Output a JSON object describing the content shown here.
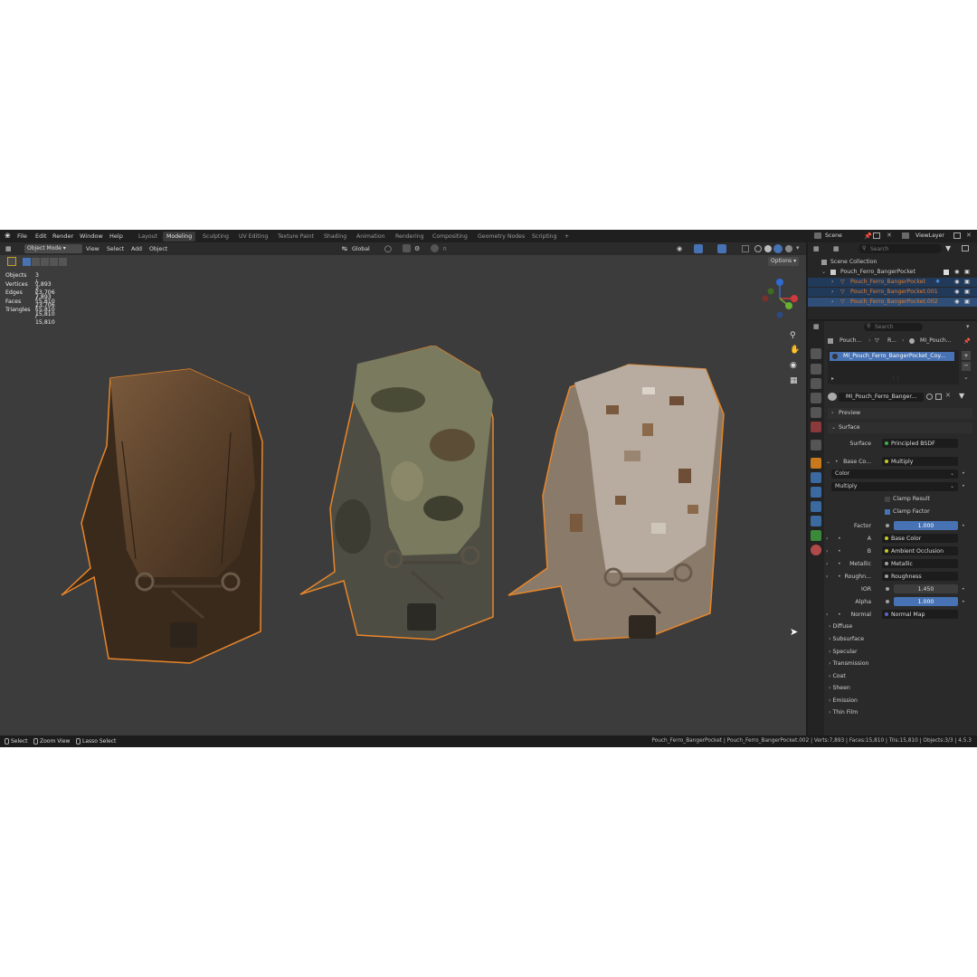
{
  "menubar": {
    "menus": [
      "File",
      "Edit",
      "Render",
      "Window",
      "Help"
    ],
    "workspaces": [
      "Layout",
      "Modeling",
      "Sculpting",
      "UV Editing",
      "Texture Paint",
      "Shading",
      "Animation",
      "Rendering",
      "Compositing",
      "Geometry Nodes",
      "Scripting"
    ],
    "active_workspace": "Modeling",
    "add_tab": "+",
    "scene": "Scene",
    "view_layer": "ViewLayer"
  },
  "viewport": {
    "mode": "Object Mode",
    "menus": [
      "View",
      "Select",
      "Add",
      "Object"
    ],
    "transform_orientation": "Global",
    "options_label": "Options",
    "stats": [
      {
        "label": "Objects",
        "value": "3 / 3"
      },
      {
        "label": "Vertices",
        "value": "7,893 / 7,893"
      },
      {
        "label": "Edges",
        "value": "23,706 / 23,706"
      },
      {
        "label": "Faces",
        "value": "15,810 / 15,810"
      },
      {
        "label": "Triangles",
        "value": "15,810 / 15,810"
      }
    ],
    "colors": {
      "background": "#3c3c3c",
      "selection_outline": "#e8862a"
    }
  },
  "outliner": {
    "search_placeholder": "Search",
    "scene_collection": "Scene Collection",
    "collection": "Pouch_Ferro_BangerPocket",
    "objects": [
      "Pouch_Ferro_BangerPocket",
      "Pouch_Ferro_BangerPocket.001",
      "Pouch_Ferro_BangerPocket.002"
    ]
  },
  "properties": {
    "search_placeholder": "Search",
    "breadcrumb": [
      "Pouch...",
      "R...",
      "MI_Pouch..."
    ],
    "material_slot": "MI_Pouch_Ferro_BangerPocket_Coy...",
    "material_name": "MI_Pouch_Ferro_Banger...",
    "panels": {
      "preview": "Preview",
      "surface": "Surface"
    },
    "surface_label": "Surface",
    "surface_value": "Principled BSDF",
    "base_color_label": "Base Co...",
    "base_color_value": "Multiply",
    "mix_type": "Color",
    "blend": "Multiply",
    "clamp_result": "Clamp Result",
    "clamp_factor": "Clamp Factor",
    "factor_label": "Factor",
    "factor_value": "1.000",
    "a_label": "A",
    "a_value": "Base Color",
    "b_label": "B",
    "b_value": "Ambient Occlusion",
    "metallic_label": "Metallic",
    "metallic_value": "Metallic",
    "roughness_label": "Roughn...",
    "roughness_value": "Roughness",
    "ior_label": "IOR",
    "ior_value": "1.450",
    "alpha_label": "Alpha",
    "alpha_value": "1.000",
    "normal_label": "Normal",
    "normal_value": "Normal Map",
    "sections": [
      "Diffuse",
      "Subsurface",
      "Specular",
      "Transmission",
      "Coat",
      "Sheen",
      "Emission",
      "Thin Film"
    ]
  },
  "statusbar": {
    "hints": [
      "Select",
      "Zoom View",
      "Lasso Select"
    ],
    "info": "Pouch_Ferro_BangerPocket | Pouch_Ferro_BangerPocket.002 | Verts:7,893 | Faces:15,810 | Tris:15,810 | Objects:3/3 | 4.5.3"
  }
}
